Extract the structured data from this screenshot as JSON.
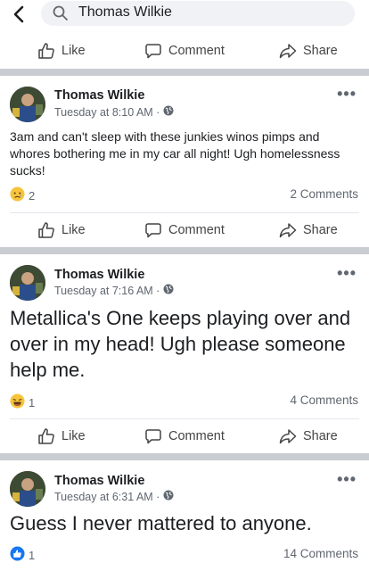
{
  "search": {
    "query": "Thomas Wilkie"
  },
  "actions": {
    "like": "Like",
    "comment": "Comment",
    "share": "Share"
  },
  "posts": [
    {
      "author": "Thomas Wilkie",
      "time": "Tuesday at 8:10 AM · ",
      "text": "3am and can't sleep with these junkies winos pimps and whores bothering me in my car all night! Ugh homelessness sucks!",
      "reaction_type": "sad",
      "reaction_count": "2",
      "comments": "2 Comments"
    },
    {
      "author": "Thomas Wilkie",
      "time": "Tuesday at 7:16 AM · ",
      "text": "Metallica's One keeps playing over and over in my head! Ugh please someone help me.",
      "reaction_type": "haha",
      "reaction_count": "1",
      "comments": "4 Comments"
    },
    {
      "author": "Thomas Wilkie",
      "time": "Tuesday at 6:31 AM · ",
      "text": "Guess I never mattered to anyone.",
      "reaction_type": "like",
      "reaction_count": "1",
      "comments": "14 Comments"
    }
  ],
  "colors": {
    "brand": "#1877f2",
    "separator": "#c9ccd1",
    "secondary_text": "#606770"
  }
}
